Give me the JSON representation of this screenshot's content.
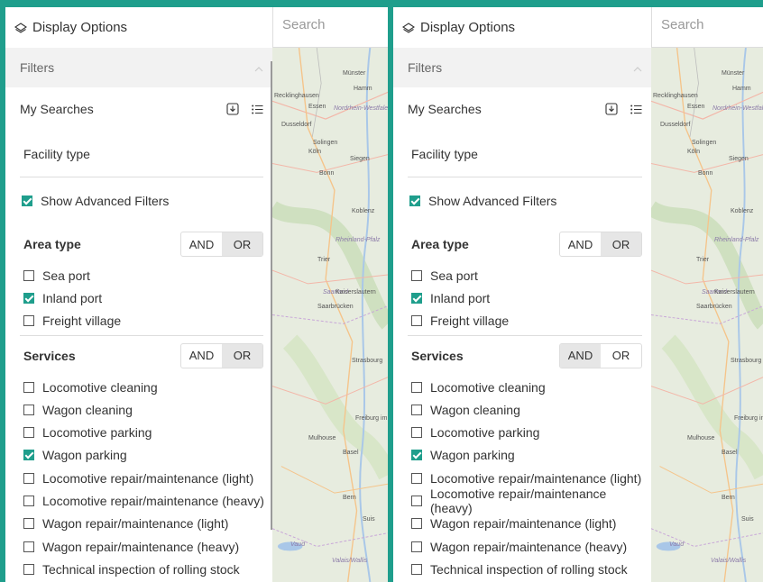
{
  "panes": [
    {
      "id": "left",
      "header": {
        "title": "Display Options",
        "icon": "layers-icon"
      },
      "search": {
        "placeholder": "Search"
      },
      "filters_label": "Filters",
      "my_searches": {
        "label": "My Searches",
        "icons": [
          "import-icon",
          "list-icon"
        ]
      },
      "facility_type": "Facility type",
      "advanced": {
        "label": "Show Advanced Filters",
        "checked": true
      },
      "area_type": {
        "title": "Area type",
        "toggle": {
          "and": "AND",
          "or": "OR",
          "active": "or"
        },
        "items": [
          {
            "label": "Sea port",
            "checked": false
          },
          {
            "label": "Inland port",
            "checked": true
          },
          {
            "label": "Freight village",
            "checked": false
          }
        ]
      },
      "services": {
        "title": "Services",
        "toggle": {
          "and": "AND",
          "or": "OR",
          "active": "or"
        },
        "items": [
          {
            "label": "Locomotive cleaning",
            "checked": false
          },
          {
            "label": "Wagon cleaning",
            "checked": false
          },
          {
            "label": "Locomotive parking",
            "checked": false
          },
          {
            "label": "Wagon parking",
            "checked": true
          },
          {
            "label": "Locomotive repair/maintenance (light)",
            "checked": false
          },
          {
            "label": "Locomotive repair/maintenance (heavy)",
            "checked": false
          },
          {
            "label": "Wagon repair/maintenance (light)",
            "checked": false
          },
          {
            "label": "Wagon repair/maintenance (heavy)",
            "checked": false
          },
          {
            "label": "Technical inspection of rolling stock",
            "checked": false
          }
        ]
      },
      "map_labels": [
        "Münster",
        "Hamm",
        "Recklinghausen",
        "Essen",
        "Nordrhein-Westfalen",
        "Dusseldorf",
        "Solingen",
        "Köln",
        "Siegen",
        "Bonn",
        "Koblenz",
        "Rheinland-Pfalz",
        "Trier",
        "Saarland",
        "Kaiserslautern",
        "Saarbrücken",
        "Strasbourg",
        "Freiburg im Breisgau",
        "Mulhouse",
        "Basel",
        "Bern",
        "Suis",
        "Vaud",
        "Valais/Wallis"
      ]
    },
    {
      "id": "right",
      "header": {
        "title": "Display Options",
        "icon": "layers-icon"
      },
      "search": {
        "placeholder": "Search"
      },
      "filters_label": "Filters",
      "my_searches": {
        "label": "My Searches",
        "icons": [
          "import-icon",
          "list-icon"
        ]
      },
      "facility_type": "Facility type",
      "advanced": {
        "label": "Show Advanced Filters",
        "checked": true
      },
      "area_type": {
        "title": "Area type",
        "toggle": {
          "and": "AND",
          "or": "OR",
          "active": "or"
        },
        "items": [
          {
            "label": "Sea port",
            "checked": false
          },
          {
            "label": "Inland port",
            "checked": true
          },
          {
            "label": "Freight village",
            "checked": false
          }
        ]
      },
      "services": {
        "title": "Services",
        "toggle": {
          "and": "AND",
          "or": "OR",
          "active": "and"
        },
        "items": [
          {
            "label": "Locomotive cleaning",
            "checked": false
          },
          {
            "label": "Wagon cleaning",
            "checked": false
          },
          {
            "label": "Locomotive parking",
            "checked": false
          },
          {
            "label": "Wagon parking",
            "checked": true
          },
          {
            "label": "Locomotive repair/maintenance (light)",
            "checked": false
          },
          {
            "label": "Locomotive repair/maintenance (heavy)",
            "checked": false
          },
          {
            "label": "Wagon repair/maintenance (light)",
            "checked": false
          },
          {
            "label": "Wagon repair/maintenance (heavy)",
            "checked": false
          },
          {
            "label": "Technical inspection of rolling stock",
            "checked": false
          }
        ]
      },
      "map_labels": [
        "Münster",
        "Hamm",
        "Recklinghausen",
        "Essen",
        "Nordrhein-Westfalen",
        "Dusseldorf",
        "Solingen",
        "Köln",
        "Siegen",
        "Bonn",
        "Koblenz",
        "Rheinland-Pfalz",
        "Trier",
        "Saarland",
        "Kaiserslautern",
        "Saarbrücken",
        "Strasbourg",
        "Freiburg im Breisgau",
        "Mulhouse",
        "Basel",
        "Bern",
        "Suis",
        "Vaud",
        "Valais/Wallis"
      ]
    }
  ],
  "colors": {
    "accent": "#1f9e8c",
    "toggle_active": "#e6e6e6",
    "filters_bg": "#f2f2f2",
    "map_bg": "#e7ecdf"
  }
}
